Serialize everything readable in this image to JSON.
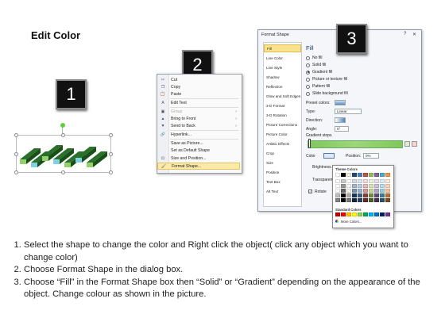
{
  "title": "Edit Color",
  "steps": {
    "one": "1",
    "two": "2",
    "three": "3"
  },
  "context_menu": {
    "items": [
      {
        "label": "Cut",
        "icon": "scissors-icon",
        "glyph": "✂"
      },
      {
        "label": "Copy",
        "icon": "copy-icon",
        "glyph": "❐"
      },
      {
        "label": "Paste",
        "icon": "paste-icon",
        "glyph": "📋"
      },
      {
        "label": "Edit Text",
        "icon": "edit-text-icon",
        "glyph": "A"
      },
      {
        "label": "Group",
        "icon": "group-icon",
        "glyph": "▣",
        "disabled": true,
        "submenu": true
      },
      {
        "label": "Bring to Front",
        "icon": "bring-front-icon",
        "glyph": "▲",
        "submenu": true
      },
      {
        "label": "Send to Back",
        "icon": "send-back-icon",
        "glyph": "▼",
        "submenu": true
      },
      {
        "label": "Hyperlink...",
        "icon": "hyperlink-icon",
        "glyph": "🔗"
      },
      {
        "label": "Save as Picture...",
        "icon": "",
        "glyph": ""
      },
      {
        "label": "Set as Default Shape",
        "icon": "",
        "glyph": ""
      },
      {
        "label": "Size and Position...",
        "icon": "size-icon",
        "glyph": "⊡"
      },
      {
        "label": "Format Shape...",
        "icon": "format-shape-icon",
        "glyph": "🖌",
        "highlighted": true
      }
    ]
  },
  "dialog": {
    "title": "Format Shape",
    "controls": {
      "help": "?",
      "close": "✕"
    },
    "nav": [
      "Fill",
      "Line Color",
      "Line Style",
      "Shadow",
      "Reflection",
      "Glow and Soft Edges",
      "3-D Format",
      "3-D Rotation",
      "Picture Corrections",
      "Picture Color",
      "Artistic Effects",
      "Crop",
      "Size",
      "Position",
      "Text Box",
      "Alt Text"
    ],
    "pane_title": "Fill",
    "fill_options": [
      "No fill",
      "Solid fill",
      "Gradient fill",
      "Picture or texture fill",
      "Pattern fill",
      "Slide background fill"
    ],
    "selected_fill": "Gradient fill",
    "preset_label": "Preset colors:",
    "type_label": "Type:",
    "type_value": "Linear",
    "direction_label": "Direction:",
    "angle_label": "Angle:",
    "angle_value": "0°",
    "stops_label": "Gradient stops",
    "color_label": "Color",
    "position_label": "Position:",
    "position_value": "0%",
    "brightness_label": "Brightness",
    "transparency_label": "Transparen",
    "rotate_label": "Rotate"
  },
  "picker": {
    "theme_label": "Theme Colors",
    "standard_label": "Standard Colors",
    "more_label": "More Colors...",
    "theme_top": [
      "#ffffff",
      "#000000",
      "#eeece1",
      "#1f497d",
      "#4f81bd",
      "#c0504d",
      "#9bbb59",
      "#8064a2",
      "#4bacc6",
      "#f79646"
    ],
    "standard": [
      "#c00000",
      "#ff0000",
      "#ffc000",
      "#ffff00",
      "#92d050",
      "#00b050",
      "#00b0f0",
      "#0070c0",
      "#002060",
      "#7030a0"
    ]
  },
  "instructions": [
    "Select the shape to change the color and Right click the object( click any object which you want to change color)",
    "Choose Format Shape in the dialog box.",
    "Choose “Fill” in the Format Shape box then “Solid” or “Gradient” depending on the appearance of the object. Change colour as shown in the picture."
  ]
}
